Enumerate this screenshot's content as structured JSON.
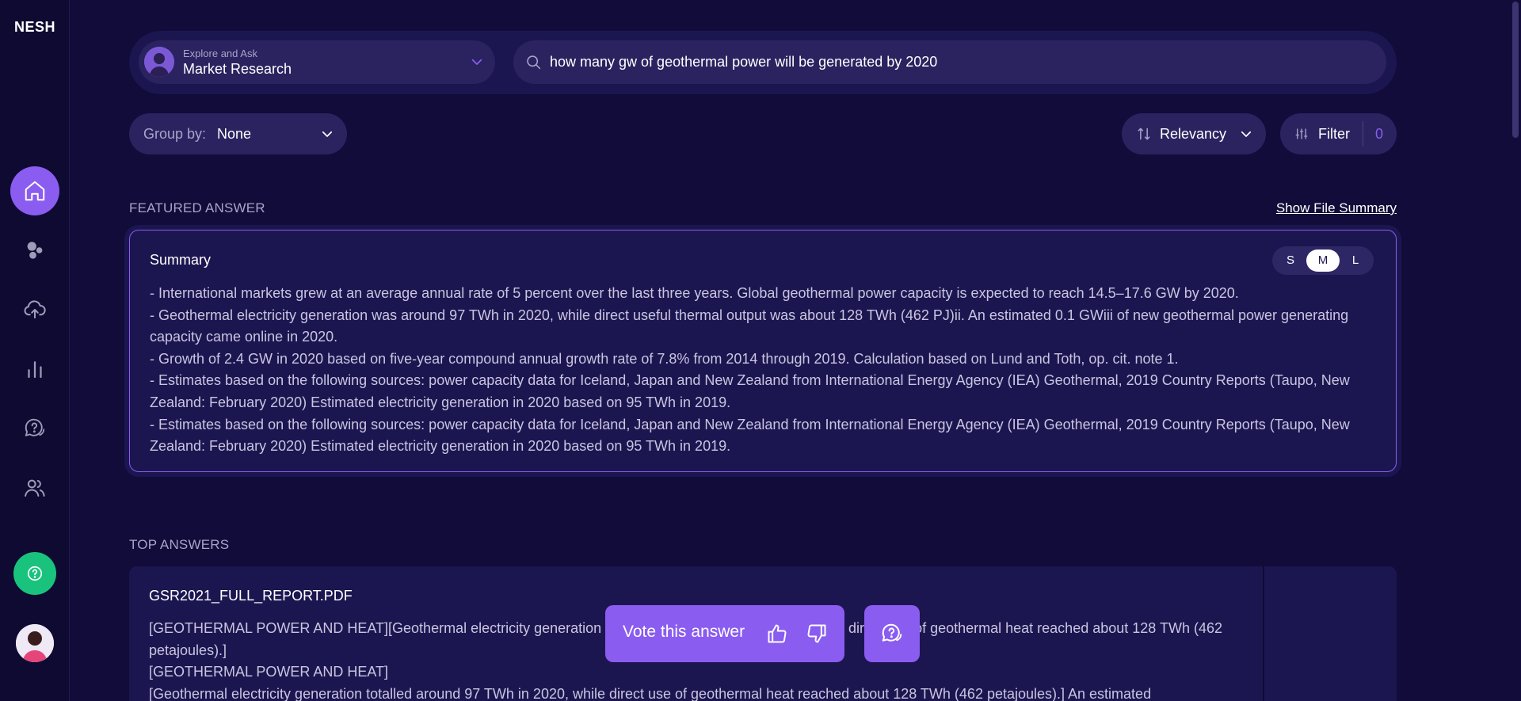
{
  "app": {
    "logo": "NESH"
  },
  "sidebar": {
    "items": [
      {
        "name": "home-icon"
      },
      {
        "name": "bubbles-icon"
      },
      {
        "name": "upload-cloud-icon"
      },
      {
        "name": "bar-chart-icon"
      },
      {
        "name": "questions-chat-icon"
      },
      {
        "name": "users-icon"
      }
    ],
    "help_icon": "help-icon",
    "accent": "#8a5cf0",
    "help_color": "#19c37d"
  },
  "search": {
    "context_caption": "Explore and Ask",
    "context_value": "Market Research",
    "query": "how many gw of geothermal power will be generated by 2020"
  },
  "controls": {
    "group_by_label": "Group by:",
    "group_by_value": "None",
    "sort_value": "Relevancy",
    "filter_label": "Filter",
    "filter_count": "0"
  },
  "featured": {
    "section_label": "FEATURED ANSWER",
    "show_summary_link": "Show File Summary",
    "title": "Summary",
    "size_options": [
      "S",
      "M",
      "L"
    ],
    "selected_size": "M",
    "lines": [
      "- International markets grew at an average annual rate of 5 percent over the last three years. Global geothermal power capacity is expected to reach 14.5–17.6 GW by 2020.",
      "- Geothermal electricity generation was around 97 TWh in 2020, while direct useful thermal output was about 128 TWh (462 PJ)ii. An estimated 0.1 GWiii of new geothermal power generating capacity came online in 2020.",
      "- Growth of 2.4 GW in 2020 based on five-year compound annual growth rate of 7.8% from 2014 through 2019. Calculation based on Lund and Toth, op. cit. note 1.",
      "- Estimates based on the following sources: power capacity data for Iceland, Japan and New Zealand from International Energy Agency (IEA) Geothermal, 2019 Country Reports (Taupo, New Zealand: February 2020) Estimated electricity generation in 2020 based on 95 TWh in 2019.",
      "- Estimates based on the following sources: power capacity data for Iceland, Japan and New Zealand from International Energy Agency (IEA) Geothermal, 2019 Country Reports (Taupo, New Zealand: February 2020) Estimated electricity generation in 2020 based on 95 TWh in 2019."
    ]
  },
  "top_answers": {
    "section_label": "TOP ANSWERS",
    "items": [
      {
        "file_name": "GSR2021_FULL_REPORT.PDF",
        "lines": [
          "[GEOTHERMAL POWER AND HEAT][Geothermal electricity generation totalled around 97 TWh in 2020, while direct use of geothermal heat reached about 128 TWh (462 petajoules).]",
          "[GEOTHERMAL POWER AND HEAT]",
          "[Geothermal electricity generation totalled around 97 TWh in 2020, while direct use of geothermal heat reached about 128 TWh (462 petajoules).] An estimated"
        ]
      }
    ]
  },
  "vote": {
    "label": "Vote this answer"
  }
}
